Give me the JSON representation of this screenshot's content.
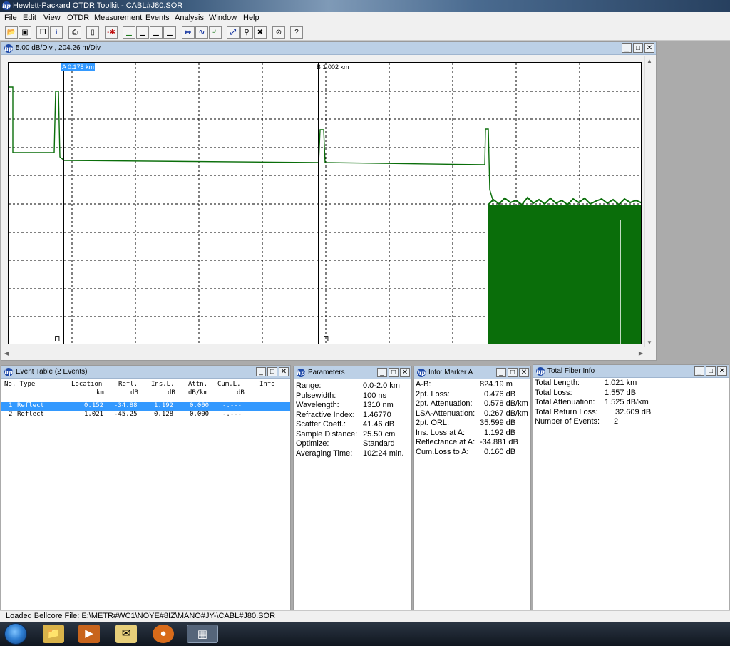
{
  "app": {
    "title": "Hewlett-Packard OTDR Toolkit - CABL#J80.SOR"
  },
  "menu": [
    "File",
    "Edit",
    "View",
    "OTDR",
    "Measurement",
    "Events",
    "Analysis",
    "Window",
    "Help"
  ],
  "trace_window": {
    "title": "5.00 dB/Div ,  204.26 m/Div",
    "marker_a": "A 0.178 km",
    "marker_b": "B 1.002 km"
  },
  "event_table": {
    "title": "Event Table (2 Events)",
    "headers": {
      "no_type": "No. Type",
      "location": "Location",
      "location_unit": "km",
      "refl": "Refl.",
      "refl_unit": "dB",
      "insl": "Ins.L.",
      "insl_unit": "dB",
      "attn": "Attn.",
      "attn_unit": "dB/km",
      "cuml": "Cum.L.",
      "cuml_unit": "dB",
      "info": "Info"
    },
    "rows": [
      {
        "no": "1",
        "type": "Reflect",
        "location": "0.152",
        "refl": "-34.88",
        "insl": "1.192",
        "attn": "0.000",
        "cuml": "-.---"
      },
      {
        "no": "2",
        "type": "Reflect",
        "location": "1.021",
        "refl": "-45.25",
        "insl": "0.128",
        "attn": "0.000",
        "cuml": "-.---"
      }
    ]
  },
  "parameters": {
    "title": "Parameters",
    "items": [
      {
        "label": "Range:",
        "value": "0.0-2.0 km"
      },
      {
        "label": "Pulsewidth:",
        "value": "100 ns"
      },
      {
        "label": "Wavelength:",
        "value": "1310 nm"
      },
      {
        "label": "Refractive Index:",
        "value": "1.46770"
      },
      {
        "label": "Scatter Coeff.:",
        "value": "41.46 dB"
      },
      {
        "label": "Sample Distance:",
        "value": "25.50 cm"
      },
      {
        "label": "Optimize:",
        "value": "Standard"
      },
      {
        "label": "Averaging Time:",
        "value": "102:24 min."
      }
    ]
  },
  "marker_info": {
    "title": "Info: Marker A",
    "items": [
      {
        "label": "A-B:",
        "value": "824.19 m"
      },
      {
        "label": "2pt. Loss:",
        "value": "0.476 dB"
      },
      {
        "label": "2pt. Attenuation:",
        "value": "0.578 dB/km"
      },
      {
        "label": "LSA-Attenuation:",
        "value": "0.267 dB/km"
      },
      {
        "label": "2pt. ORL:",
        "value": "35.599 dB"
      },
      {
        "label": "Ins. Loss at A:",
        "value": "1.192 dB"
      },
      {
        "label": "Reflectance at A:",
        "value": "-34.881 dB"
      },
      {
        "label": "Cum.Loss to A:",
        "value": "0.160 dB"
      }
    ]
  },
  "total_fiber": {
    "title": "Total Fiber Info",
    "items": [
      {
        "label": "Total Length:",
        "value": "1.021 km"
      },
      {
        "label": "Total Loss:",
        "value": "1.557 dB"
      },
      {
        "label": "Total Attenuation:",
        "value": "1.525 dB/km"
      },
      {
        "label": "Total Return Loss:",
        "value": "32.609 dB"
      },
      {
        "label": "Number of Events:",
        "value": "2"
      }
    ]
  },
  "status": {
    "text": "Loaded Bellcore File:  E:\\METR#WC1\\NOYE#8IZ\\MANO#JY-\\CABL#J80.SOR"
  },
  "colors": {
    "trace": "#0a6e0a",
    "selection": "#3399ff",
    "window_title": "#bcd0e6"
  },
  "icons": {
    "toolbar": [
      "open-icon",
      "save-icon",
      "copy-icon",
      "info-icon",
      "print-icon",
      "device-icon",
      "event-marker-icon",
      "level-icon-1",
      "level-icon-2",
      "level-icon-3",
      "span-icon",
      "splice-icon",
      "reflect-icon",
      "auto-icon",
      "zoom-icon",
      "zoom-reset-icon",
      "cancel-icon",
      "help-icon"
    ],
    "taskbar": [
      "start-icon",
      "explorer-icon",
      "media-player-icon",
      "mail-icon",
      "firefox-icon",
      "otdr-toolkit-icon"
    ]
  }
}
